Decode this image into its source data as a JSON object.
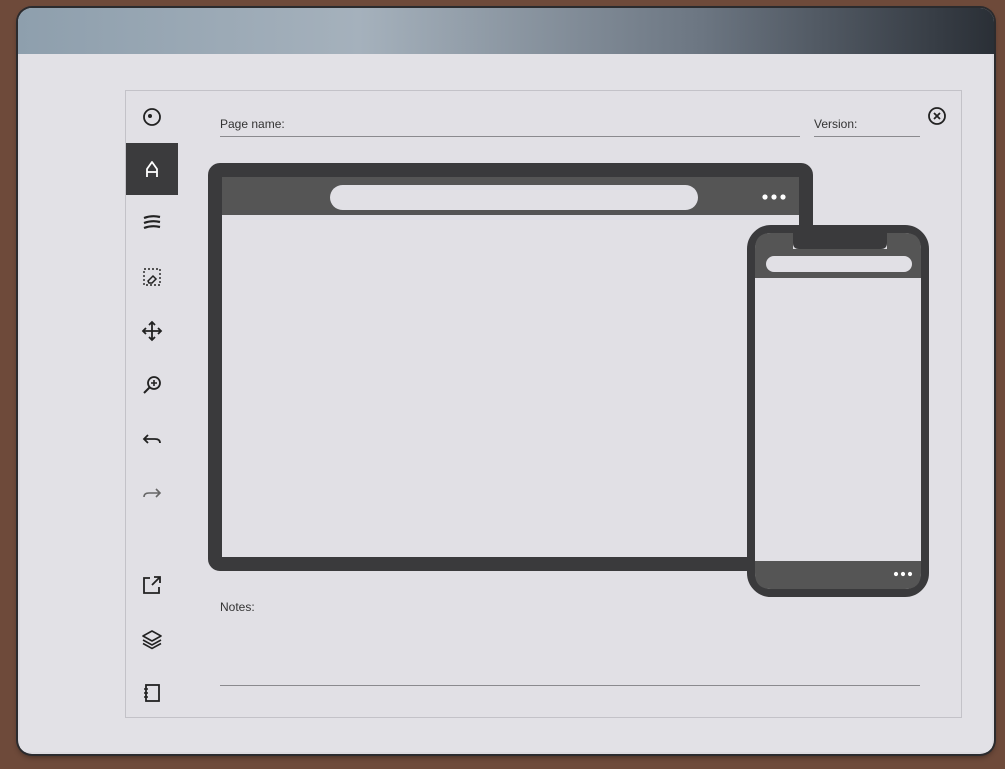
{
  "form": {
    "page_name_label": "Page name:",
    "page_name_value": "",
    "version_label": "Version:",
    "version_value": "",
    "notes_label": "Notes:",
    "notes_value": ""
  },
  "toolbar": {
    "tools": [
      {
        "icon": "menu-icon"
      },
      {
        "icon": "pen-icon",
        "active": true
      },
      {
        "icon": "brush-stroke-icon"
      },
      {
        "icon": "selection-eraser-icon"
      },
      {
        "icon": "move-icon"
      },
      {
        "icon": "zoom-in-icon"
      },
      {
        "icon": "undo-icon"
      },
      {
        "icon": "redo-icon"
      },
      {
        "icon": "export-icon"
      },
      {
        "icon": "layers-icon"
      },
      {
        "icon": "notebook-icon"
      }
    ]
  },
  "mockup": {
    "desktop_menu_glyph": "•••",
    "phone_menu_glyph": "•••"
  },
  "colors": {
    "frame_dark": "#3a3a3c",
    "bar_gray": "#555555",
    "paper": "#e1e0e5"
  }
}
